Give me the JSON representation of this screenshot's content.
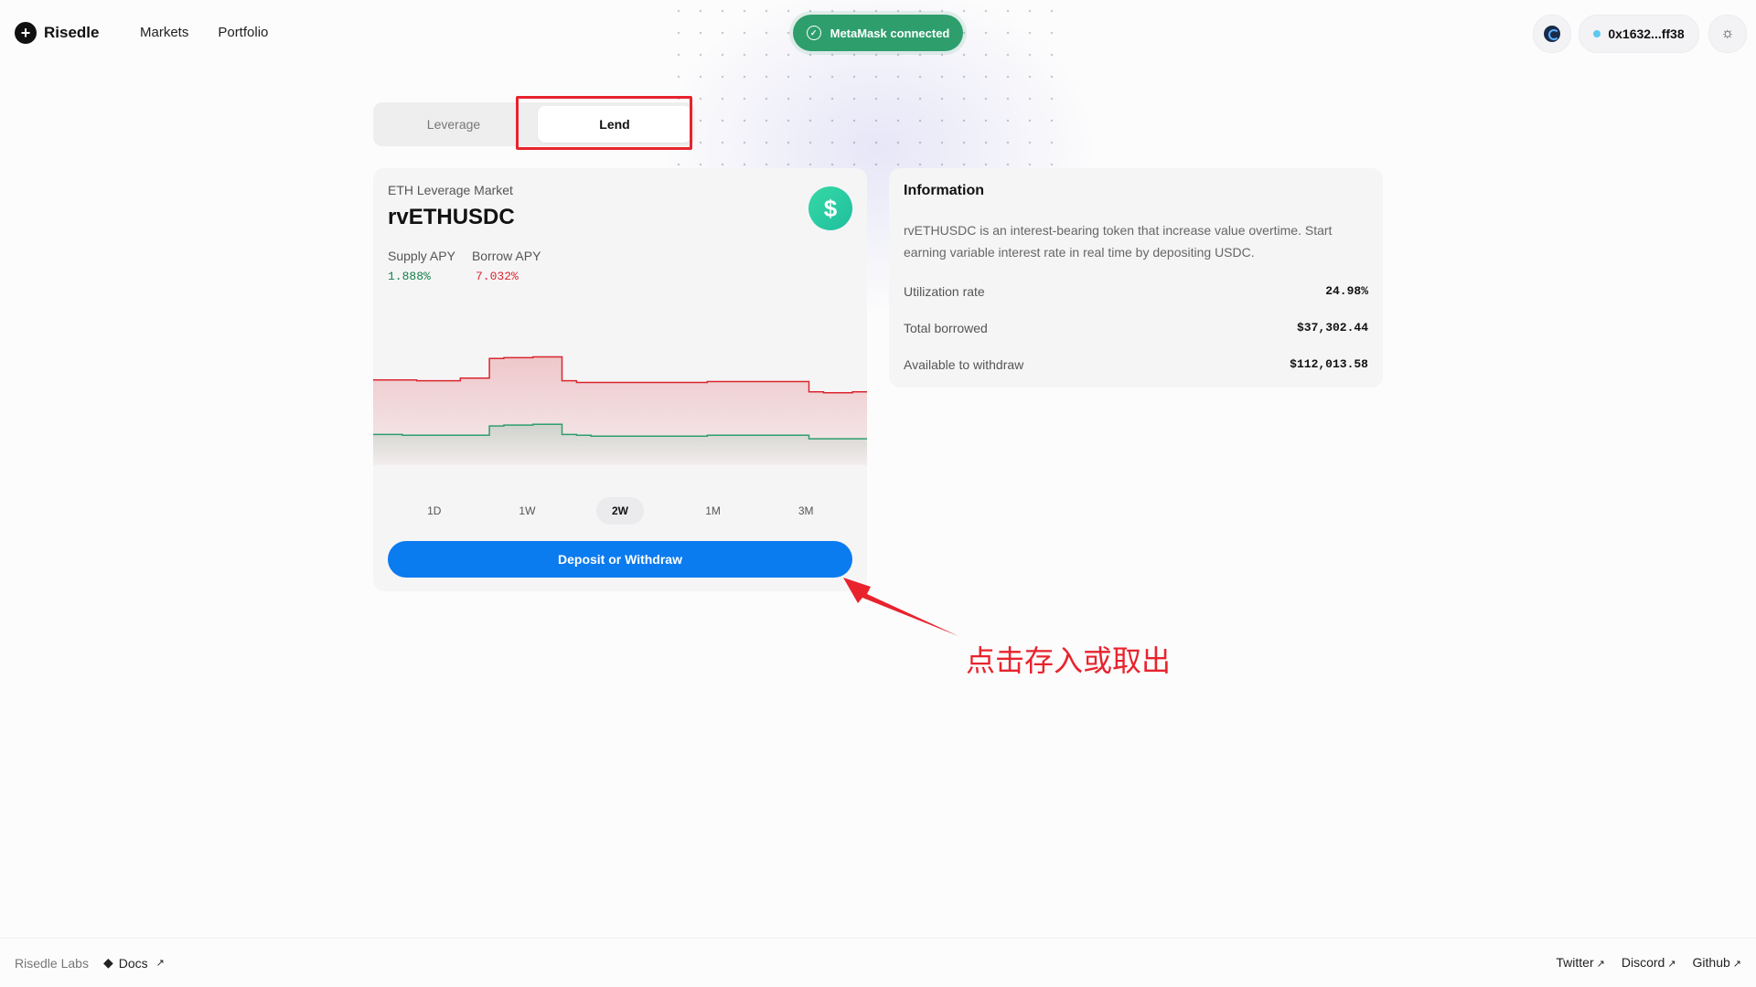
{
  "header": {
    "brand": "Risedle",
    "nav": [
      "Markets",
      "Portfolio"
    ],
    "metamask_status": "MetaMask connected",
    "wallet_address": "0x1632...ff38"
  },
  "tabs": {
    "leverage": "Leverage",
    "lend": "Lend",
    "active": "Lend"
  },
  "market": {
    "label": "ETH Leverage Market",
    "name": "rvETHUSDC",
    "supply_label": "Supply APY",
    "borrow_label": "Borrow APY",
    "supply_apy": "1.888%",
    "borrow_apy": "7.032%",
    "ranges": [
      "1D",
      "1W",
      "2W",
      "1M",
      "3M"
    ],
    "active_range": "2W",
    "cta": "Deposit or Withdraw"
  },
  "chart_data": {
    "type": "area",
    "series": [
      {
        "values": [
          10.0,
          10.0,
          10.0,
          9.9,
          9.9,
          9.9,
          10.2,
          10.2,
          12.5,
          12.6,
          12.6,
          12.7,
          12.7,
          9.9,
          9.7,
          9.7,
          9.7,
          9.7,
          9.7,
          9.7,
          9.7,
          9.7,
          9.7,
          9.8,
          9.8,
          9.8,
          9.8,
          9.8,
          9.8,
          9.8,
          8.6,
          8.5,
          8.5,
          8.6
        ]
      },
      {
        "values": [
          3.6,
          3.6,
          3.5,
          3.5,
          3.5,
          3.5,
          3.5,
          3.5,
          4.6,
          4.7,
          4.7,
          4.8,
          4.8,
          3.6,
          3.5,
          3.4,
          3.4,
          3.4,
          3.4,
          3.4,
          3.4,
          3.4,
          3.4,
          3.5,
          3.5,
          3.5,
          3.5,
          3.5,
          3.5,
          3.5,
          3.1,
          3.1,
          3.1,
          3.1
        ]
      }
    ],
    "colors": [
      "#d9262f",
      "#2e9e6d"
    ]
  },
  "information": {
    "title": "Information",
    "description": "rvETHUSDC is an interest-bearing token that increase value overtime. Start earning variable interest rate in real time by depositing USDC.",
    "rows": [
      {
        "label": "Utilization rate",
        "value": "24.98%"
      },
      {
        "label": "Total borrowed",
        "value": "$37,302.44"
      },
      {
        "label": "Available to withdraw",
        "value": "$112,013.58"
      }
    ]
  },
  "annotation": {
    "text": "点击存入或取出",
    "color": "#e8232d"
  },
  "footer": {
    "labs": "Risedle Labs",
    "docs": "Docs",
    "links": [
      "Twitter",
      "Discord",
      "Github"
    ]
  },
  "colors": {
    "accent": "#0b7bf0",
    "connected": "#2e9e6d",
    "annotation": "#e8232d"
  }
}
